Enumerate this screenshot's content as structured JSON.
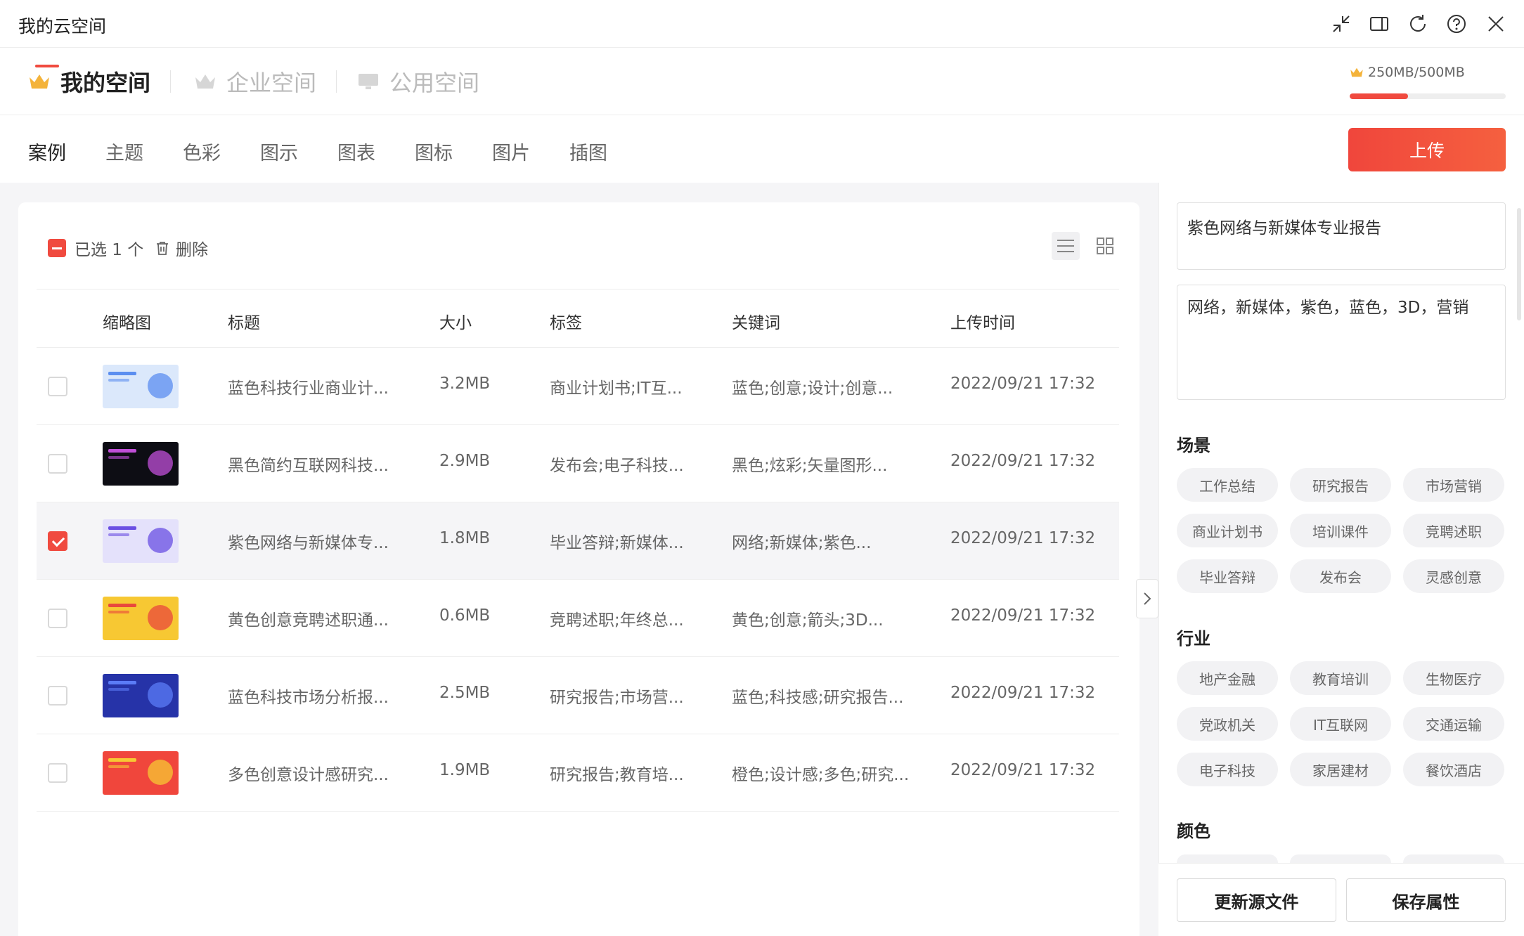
{
  "app": {
    "title": "我的云空间"
  },
  "window_controls": [
    {
      "name": "minimize-icon"
    },
    {
      "name": "panel-toggle-icon"
    },
    {
      "name": "refresh-icon"
    },
    {
      "name": "help-icon"
    },
    {
      "name": "close-icon"
    }
  ],
  "spaces": {
    "items": [
      {
        "label": "我的空间",
        "active": true
      },
      {
        "label": "企业空间",
        "active": false
      },
      {
        "label": "公用空间",
        "active": false
      }
    ],
    "quota_text": "250MB/500MB",
    "quota_fraction": 0.5
  },
  "categories": {
    "items": [
      "案例",
      "主题",
      "色彩",
      "图示",
      "图表",
      "图标",
      "图片",
      "插图"
    ],
    "active": "案例"
  },
  "upload_label": "上传",
  "toolbar": {
    "selected_text": "已选 1 个",
    "delete_label": "删除"
  },
  "table": {
    "headers": [
      "缩略图",
      "标题",
      "大小",
      "标签",
      "关键词",
      "上传时间"
    ],
    "rows": [
      {
        "checked": false,
        "title": "蓝色科技行业商业计...",
        "size": "3.2MB",
        "tags": "商业计划书;IT互...",
        "keywords": "蓝色;创意;设计;创意...",
        "time": "2022/09/21 17:32",
        "thumb_bg": "#dbe8fb",
        "thumb_accent": "#5b8ef0"
      },
      {
        "checked": false,
        "title": "黑色简约互联网科技...",
        "size": "2.9MB",
        "tags": "发布会;电子科技...",
        "keywords": "黑色;炫彩;矢量图形...",
        "time": "2022/09/21 17:32",
        "thumb_bg": "#0d0d14",
        "thumb_accent": "#c04fd8"
      },
      {
        "checked": true,
        "title": "紫色网络与新媒体专...",
        "size": "1.8MB",
        "tags": "毕业答辩;新媒体...",
        "keywords": "网络;新媒体;紫色...",
        "time": "2022/09/21 17:32",
        "thumb_bg": "#e4e1fb",
        "thumb_accent": "#6a4fe3"
      },
      {
        "checked": false,
        "title": "黄色创意竞聘述职通...",
        "size": "0.6MB",
        "tags": "竞聘述职;年终总...",
        "keywords": "黄色;创意;箭头;3D...",
        "time": "2022/09/21 17:32",
        "thumb_bg": "#f7c833",
        "thumb_accent": "#e9483c"
      },
      {
        "checked": false,
        "title": "蓝色科技市场分析报...",
        "size": "2.5MB",
        "tags": "研究报告;市场营...",
        "keywords": "蓝色;科技感;研究报告...",
        "time": "2022/09/21 17:32",
        "thumb_bg": "#2633a8",
        "thumb_accent": "#5b7cf7"
      },
      {
        "checked": false,
        "title": "多色创意设计感研究...",
        "size": "1.9MB",
        "tags": "研究报告;教育培...",
        "keywords": "橙色;设计感;多色;研究...",
        "time": "2022/09/21 17:32",
        "thumb_bg": "#f0463c",
        "thumb_accent": "#f7c833"
      }
    ]
  },
  "detail": {
    "title_value": "紫色网络与新媒体专业报告",
    "keywords_value": "网络，新媒体，紫色，蓝色，3D，营销",
    "sections": [
      {
        "title": "场景",
        "chips": [
          "工作总结",
          "研究报告",
          "市场营销",
          "商业计划书",
          "培训课件",
          "竞聘述职",
          "毕业答辩",
          "发布会",
          "灵感创意"
        ]
      },
      {
        "title": "行业",
        "chips": [
          "地产金融",
          "教育培训",
          "生物医疗",
          "党政机关",
          "IT互联网",
          "交通运输",
          "电子科技",
          "家居建材",
          "餐饮酒店"
        ]
      },
      {
        "title": "颜色",
        "chips": []
      }
    ],
    "update_source_label": "更新源文件",
    "save_props_label": "保存属性"
  },
  "colors": {
    "accent": "#f04a3f",
    "crown_gold": "#f4b33a"
  }
}
